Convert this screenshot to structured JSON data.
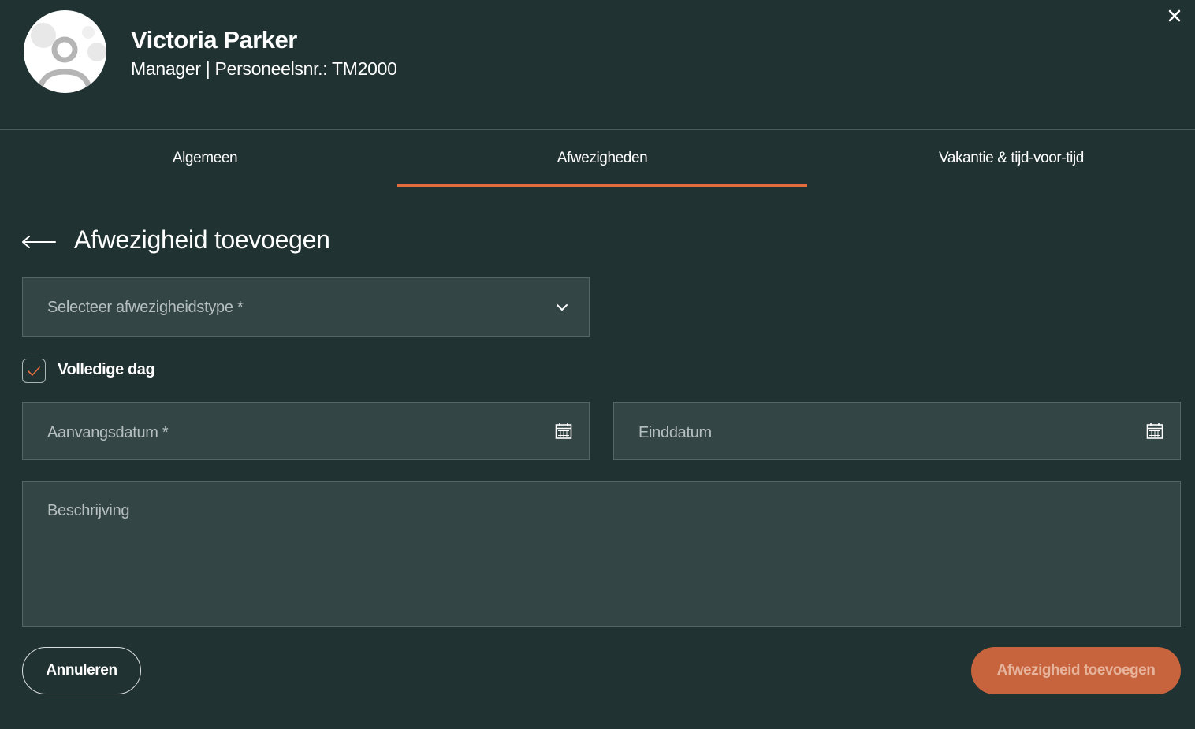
{
  "profile": {
    "name": "Victoria Parker",
    "subtitle": "Manager | Personeelsnr.: TM2000"
  },
  "tabs": [
    {
      "label": "Algemeen",
      "active": false
    },
    {
      "label": "Afwezigheden",
      "active": true
    },
    {
      "label": "Vakantie & tijd-voor-tijd",
      "active": false
    }
  ],
  "form": {
    "title": "Afwezigheid toevoegen",
    "type_placeholder": "Selecteer afwezigheidstype *",
    "full_day_label": "Volledige dag",
    "full_day_checked": true,
    "start_placeholder": "Aanvangsdatum *",
    "end_placeholder": "Einddatum",
    "description_placeholder": "Beschrijving"
  },
  "actions": {
    "cancel_label": "Annuleren",
    "submit_label": "Afwezigheid toevoegen"
  },
  "colors": {
    "background": "#213232",
    "field": "#344545",
    "accent": "#e36c3e",
    "button": "#c7643e"
  },
  "icons": {
    "close": "close-icon",
    "back": "arrow-left-icon",
    "dropdown": "chevron-down-icon",
    "check": "check-icon",
    "calendar": "calendar-icon"
  }
}
